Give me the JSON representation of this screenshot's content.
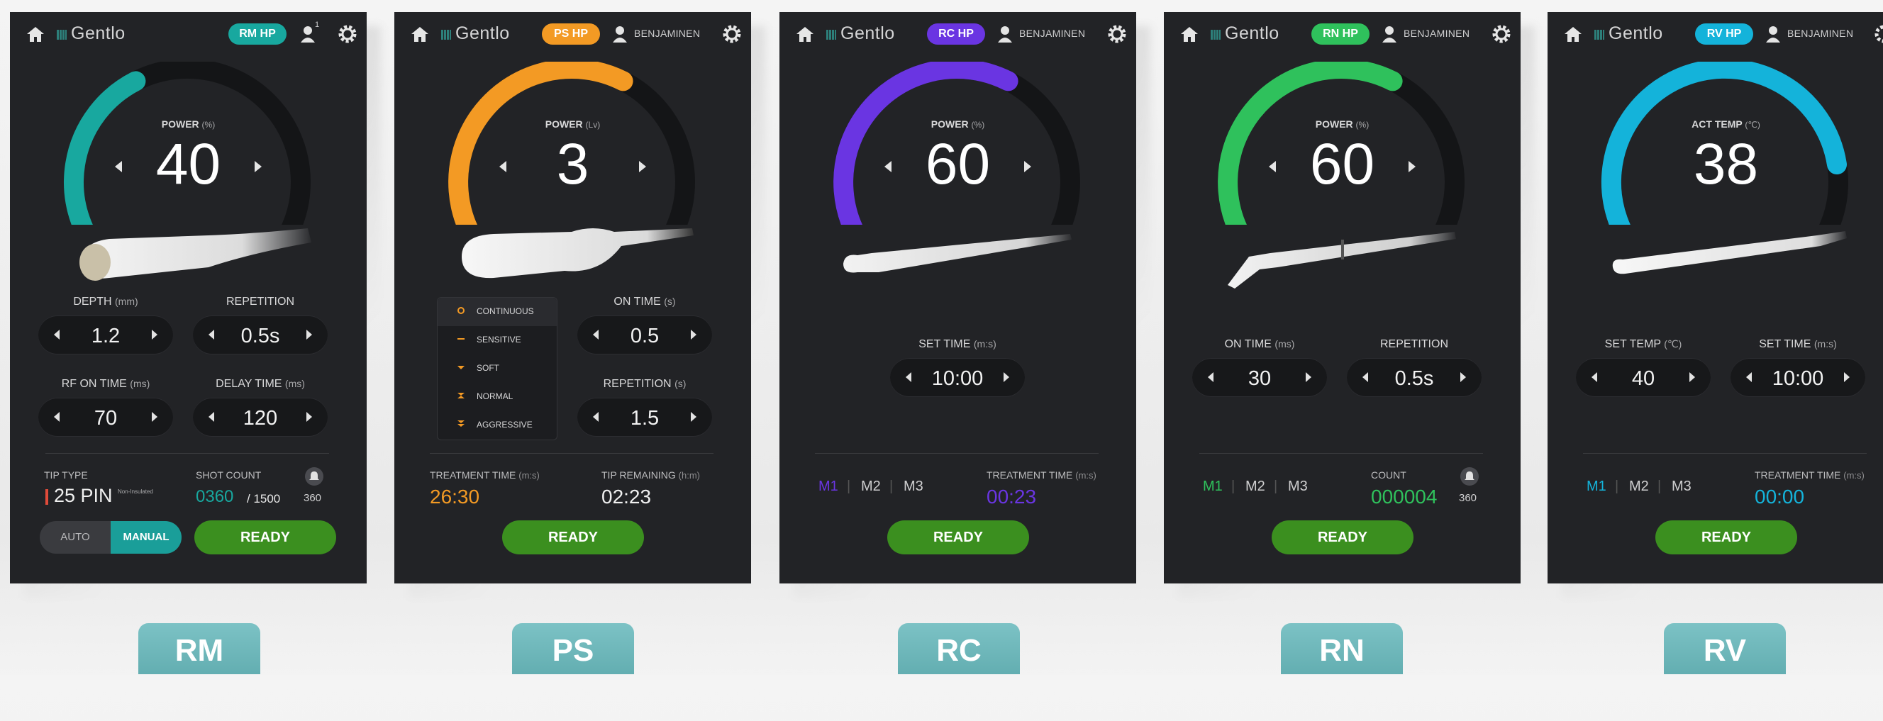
{
  "colors": {
    "rm": "#18a89f",
    "ps": "#f39a24",
    "rc": "#6a35e2",
    "rn": "#2fc15c",
    "rv": "#14b3da",
    "ready": "#3b8f1f",
    "panel_bg": "#222326"
  },
  "brand": "Gentlo",
  "username": "BENJAMINEN",
  "ready_label": "READY",
  "panels": [
    {
      "badge": "RM HP",
      "gauge": {
        "label": "POWER",
        "unit": "(%)",
        "value": "40",
        "fraction": 0.4
      },
      "fields": [
        {
          "label": "DEPTH",
          "unit": "(mm)",
          "value": "1.2"
        },
        {
          "label": "REPETITION",
          "unit": "",
          "value": "0.5s"
        },
        {
          "label": "RF ON TIME",
          "unit": "(ms)",
          "value": "70"
        },
        {
          "label": "DELAY TIME",
          "unit": "(ms)",
          "value": "120"
        }
      ],
      "tip_type_label": "TIP TYPE",
      "tip_type_value": "25 PIN",
      "tip_type_note": "Non-Insulated",
      "shot_count_label": "SHOT COUNT",
      "shot_count_value": "0360",
      "shot_count_total": "/ 1500",
      "bell_count": "360",
      "toggle_auto": "AUTO",
      "toggle_manual": "MANUAL",
      "user_badge": "1"
    },
    {
      "badge": "PS HP",
      "gauge": {
        "label": "POWER",
        "unit": "(Lv)",
        "value": "3",
        "fraction": 0.6
      },
      "modes": [
        "CONTINUOUS",
        "SENSITIVE",
        "SOFT",
        "NORMAL",
        "AGGRESSIVE"
      ],
      "selected_mode": "CONTINUOUS",
      "fields": [
        {
          "label": "ON TIME",
          "unit": "(s)",
          "value": "0.5"
        },
        {
          "label": "REPETITION",
          "unit": "(s)",
          "value": "1.5"
        }
      ],
      "treatment_label": "TREATMENT TIME",
      "treatment_unit": "(m:s)",
      "treatment_value": "26:30",
      "tip_remaining_label": "TIP REMAINING",
      "tip_remaining_unit": "(h:m)",
      "tip_remaining_value": "02:23"
    },
    {
      "badge": "RC HP",
      "gauge": {
        "label": "POWER",
        "unit": "(%)",
        "value": "60",
        "fraction": 0.6
      },
      "fields": [
        {
          "label": "SET TIME",
          "unit": "(m:s)",
          "value": "10:00"
        }
      ],
      "memory_tabs": [
        "M1",
        "M2",
        "M3"
      ],
      "treatment_label": "TREATMENT TIME",
      "treatment_unit": "(m:s)",
      "treatment_value": "00:23"
    },
    {
      "badge": "RN HP",
      "gauge": {
        "label": "POWER",
        "unit": "(%)",
        "value": "60",
        "fraction": 0.6
      },
      "fields": [
        {
          "label": "ON TIME",
          "unit": "(ms)",
          "value": "30"
        },
        {
          "label": "REPETITION",
          "unit": "",
          "value": "0.5s"
        }
      ],
      "memory_tabs": [
        "M1",
        "M2",
        "M3"
      ],
      "count_label": "COUNT",
      "count_value": "000004",
      "bell_count": "360"
    },
    {
      "badge": "RV HP",
      "gauge": {
        "label": "ACT TEMP",
        "unit": "(℃)",
        "value": "38",
        "fraction": 0.8
      },
      "fields": [
        {
          "label": "SET TEMP",
          "unit": "(℃)",
          "value": "40"
        },
        {
          "label": "SET TIME",
          "unit": "(m:s)",
          "value": "10:00"
        }
      ],
      "memory_tabs": [
        "M1",
        "M2",
        "M3"
      ],
      "treatment_label": "TREATMENT TIME",
      "treatment_unit": "(m:s)",
      "treatment_value": "00:00"
    }
  ],
  "captions": [
    "RM",
    "PS",
    "RC",
    "RN",
    "RV"
  ]
}
